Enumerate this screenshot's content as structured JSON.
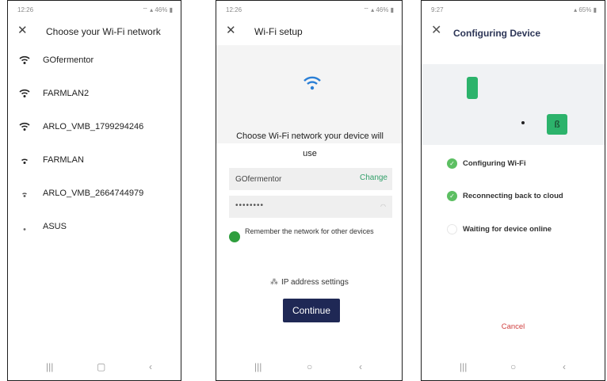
{
  "screen1": {
    "status": {
      "time": "12:26",
      "right": "46%"
    },
    "title": "Choose your Wi-Fi network",
    "networks": [
      "GOfermentor",
      "FARMLAN2",
      "ARLO_VMB_1799294246",
      "FARMLAN",
      "ARLO_VMB_2664744979",
      "ASUS"
    ],
    "nav": [
      "|||",
      "▢",
      "‹"
    ]
  },
  "screen2": {
    "status": {
      "time": "12:26",
      "right": "46%"
    },
    "title": "Wi-Fi setup",
    "prompt": "Choose Wi-Fi network your device will use",
    "ssid": "GOfermentor",
    "change": "Change",
    "password_mask": "••••••••",
    "remember": "Remember the network for other devices",
    "ip_settings": "IP address settings",
    "continue": "Continue",
    "nav": [
      "|||",
      "○",
      "‹"
    ]
  },
  "screen3": {
    "status": {
      "time": "9:27",
      "right": "65%"
    },
    "title": "Configuring Device",
    "steps": [
      {
        "label": "Configuring Wi-Fi",
        "done": true
      },
      {
        "label": "Reconnecting back to cloud",
        "done": true
      },
      {
        "label": "Waiting for device online",
        "done": false
      }
    ],
    "cancel": "Cancel",
    "nav": [
      "|||",
      "○",
      "‹"
    ]
  },
  "colors": {
    "accent_green": "#2cb36b",
    "button_navy": "#1f2855",
    "change_green": "#33a06a",
    "cancel_red": "#d04040"
  }
}
